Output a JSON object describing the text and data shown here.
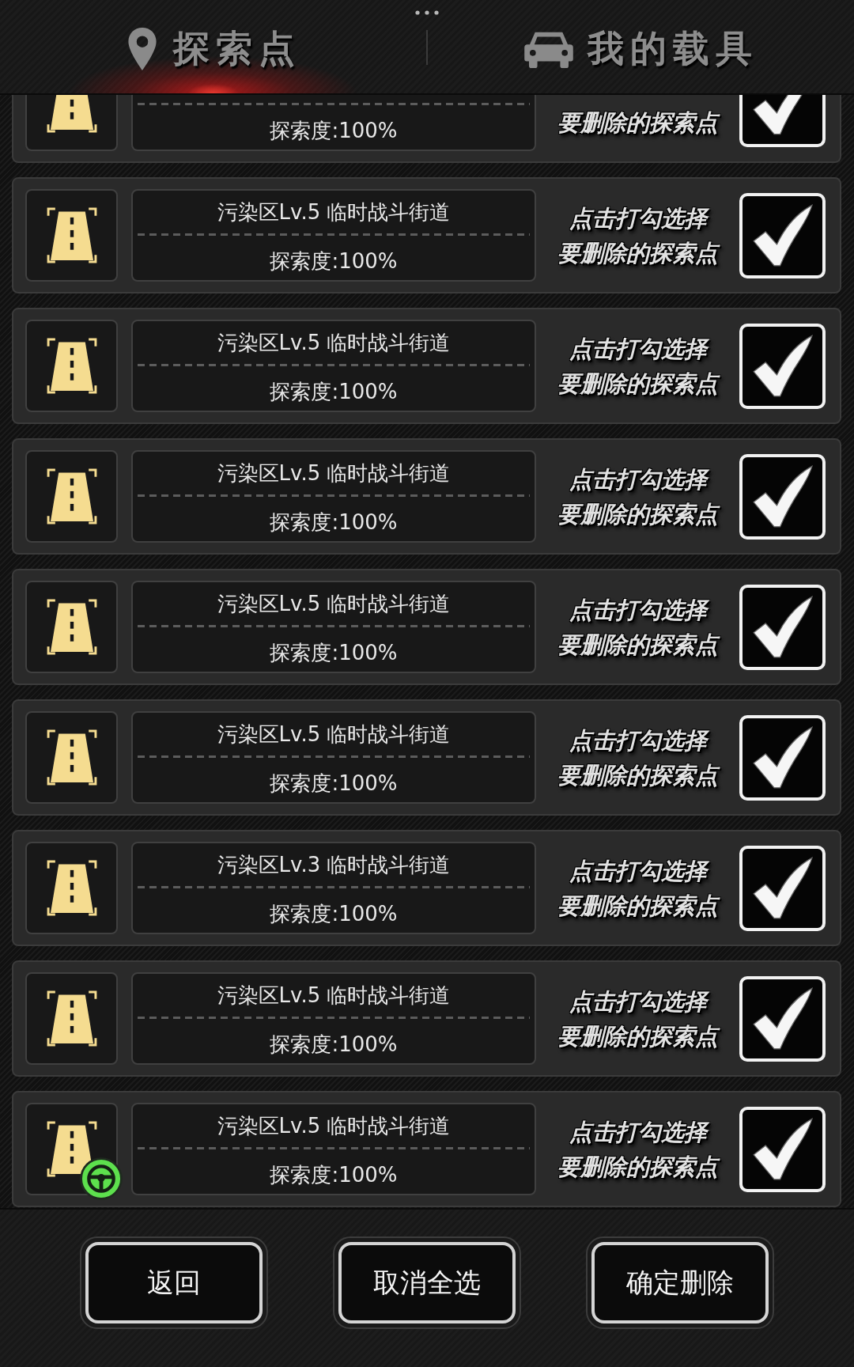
{
  "header": {
    "tabs": [
      {
        "label": "探索点",
        "selected": true
      },
      {
        "label": "我的载具",
        "selected": false
      }
    ]
  },
  "rows": [
    {
      "kind": "cut",
      "progress": "探索度:100%",
      "hint": [
        "要删除的探索点"
      ],
      "checked": true,
      "vehicle": false
    },
    {
      "kind": "full",
      "title": "污染区Lv.5 临时战斗街道",
      "progress": "探索度:100%",
      "hint": [
        "点击打勾选择",
        "要删除的探索点"
      ],
      "checked": true,
      "vehicle": false
    },
    {
      "kind": "full",
      "title": "污染区Lv.5 临时战斗街道",
      "progress": "探索度:100%",
      "hint": [
        "点击打勾选择",
        "要删除的探索点"
      ],
      "checked": true,
      "vehicle": false
    },
    {
      "kind": "full",
      "title": "污染区Lv.5 临时战斗街道",
      "progress": "探索度:100%",
      "hint": [
        "点击打勾选择",
        "要删除的探索点"
      ],
      "checked": true,
      "vehicle": false
    },
    {
      "kind": "full",
      "title": "污染区Lv.5 临时战斗街道",
      "progress": "探索度:100%",
      "hint": [
        "点击打勾选择",
        "要删除的探索点"
      ],
      "checked": true,
      "vehicle": false
    },
    {
      "kind": "full",
      "title": "污染区Lv.5 临时战斗街道",
      "progress": "探索度:100%",
      "hint": [
        "点击打勾选择",
        "要删除的探索点"
      ],
      "checked": true,
      "vehicle": false
    },
    {
      "kind": "full",
      "title": "污染区Lv.3 临时战斗街道",
      "progress": "探索度:100%",
      "hint": [
        "点击打勾选择",
        "要删除的探索点"
      ],
      "checked": true,
      "vehicle": false
    },
    {
      "kind": "full",
      "title": "污染区Lv.5 临时战斗街道",
      "progress": "探索度:100%",
      "hint": [
        "点击打勾选择",
        "要删除的探索点"
      ],
      "checked": true,
      "vehicle": false
    },
    {
      "kind": "full",
      "title": "污染区Lv.5 临时战斗街道",
      "progress": "探索度:100%",
      "hint": [
        "点击打勾选择",
        "要删除的探索点"
      ],
      "checked": true,
      "vehicle": true
    }
  ],
  "buttons": [
    "返回",
    "取消全选",
    "确定删除"
  ]
}
